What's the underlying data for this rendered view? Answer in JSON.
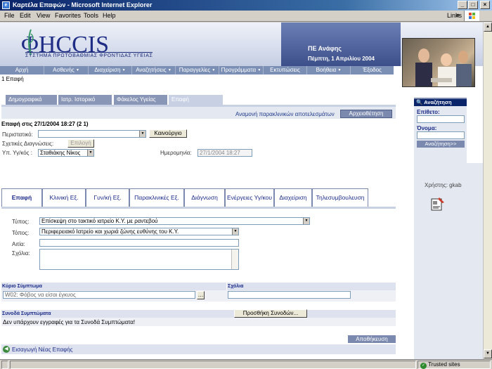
{
  "window": {
    "title": "Καρτέλα Επαφών - Microsoft Internet Explorer",
    "menu": [
      "File",
      "Edit",
      "View",
      "Favorites",
      "Tools",
      "Help"
    ],
    "links_label": "Links",
    "status_text": "Trusted sites"
  },
  "header": {
    "logo_text": "ΦHCCIS",
    "logo_subtitle": "ΣΥΣΤΗΜΑ ΠΡΩΤΟΒΑΘΜΙΑΣ ΦΡΟΝΤΙΔΑΣ ΥΓΕΙΑΣ",
    "user_name": "ΠΕ Ανάφης",
    "date": "Πέμπτη, 1 Απριλίου 2004"
  },
  "nav": {
    "items": [
      {
        "label": "Αρχή",
        "dropdown": false
      },
      {
        "label": "Ασθενής",
        "dropdown": true
      },
      {
        "label": "Διαχείριση",
        "dropdown": true
      },
      {
        "label": "Αναζητήσεις",
        "dropdown": true
      },
      {
        "label": "Παραγγελίες",
        "dropdown": true
      },
      {
        "label": "Προγράμματα",
        "dropdown": true
      },
      {
        "label": "Εκτυπώσεις",
        "dropdown": false
      },
      {
        "label": "Βοήθεια",
        "dropdown": true
      },
      {
        "label": "Έξοδος",
        "dropdown": false
      }
    ],
    "breadcrumb": "1 Επαφή"
  },
  "top_tabs": [
    {
      "label": "Δημογραφικά",
      "active": false
    },
    {
      "label": "Ιατρ. Ιστορικό",
      "active": false
    },
    {
      "label": "Φάκελος Υγείας",
      "active": false
    },
    {
      "label": "Επαφή",
      "active": true
    }
  ],
  "form": {
    "pending_text": "Αναμονή παρακλινικών αποτελεσμάτων",
    "archive_button": "Αρχειοθέτηση",
    "event_title": "Επαφή στις 27/1/2004 18:27 (2 1)",
    "incident_label": "Περιστατικό:",
    "incident_value": "",
    "new_button": "Καινούργιο",
    "diagnosis_label": "Σχετικές Διαγνώσεις:",
    "select_button": "Επιλογή",
    "physician_label": "Υπ. Υγ/κός :",
    "physician_value": "Σταθιάκης Νίκος",
    "date_label": "Ημερομηνία:",
    "date_value": "27/1/2004 18:27"
  },
  "sub_tabs": [
    {
      "label": "Επαφή",
      "active": true
    },
    {
      "label": "Κλινική Εξ.",
      "active": false
    },
    {
      "label": "Γυν/κή Εξ.",
      "active": false
    },
    {
      "label": "Παρακλινικές Εξ.",
      "active": false
    },
    {
      "label": "Διάγνωση",
      "active": false
    },
    {
      "label": "Ενέργειες Υγ/κου",
      "active": false
    },
    {
      "label": "Διαχείριση",
      "active": false
    },
    {
      "label": "Τηλεσυμβουλευση",
      "active": false
    }
  ],
  "contact": {
    "type_label": "Τύπος:",
    "type_value": "Επίσκεψη στο τακτικό ιατρείο Κ.Υ. με ραντεβού",
    "place_label": "Τόπος:",
    "place_value": "Περιφερειακό Ιατρείο και χωριά ζώνης ευθύνης του Κ.Υ.",
    "reason_label": "Αιτία:",
    "comments_label": "Σχόλια:"
  },
  "symptoms": {
    "main_header": "Κύριο Σύμπτωμα",
    "comments_header": "Σχόλια",
    "main_value": "W02: Φόβος να είσαι έγκυος",
    "co_header": "Συνοδά Συμπτώματα",
    "add_button": "Προσθήκη Συνοδών...",
    "empty_text": "Δεν υπάρχουν εγγραφές για τα Συνοδά Συμπτώματα!"
  },
  "actions": {
    "save_button": "Αποθήκευση",
    "new_contact": "Εισαγωγή Νέας Επαφής"
  },
  "search": {
    "title": "Αναζήτηση",
    "surname_label": "Επίθετο:",
    "name_label": "Όνομα:",
    "button": "Αναζήτηση>>",
    "user_code": "Χρήστης: gkab"
  }
}
